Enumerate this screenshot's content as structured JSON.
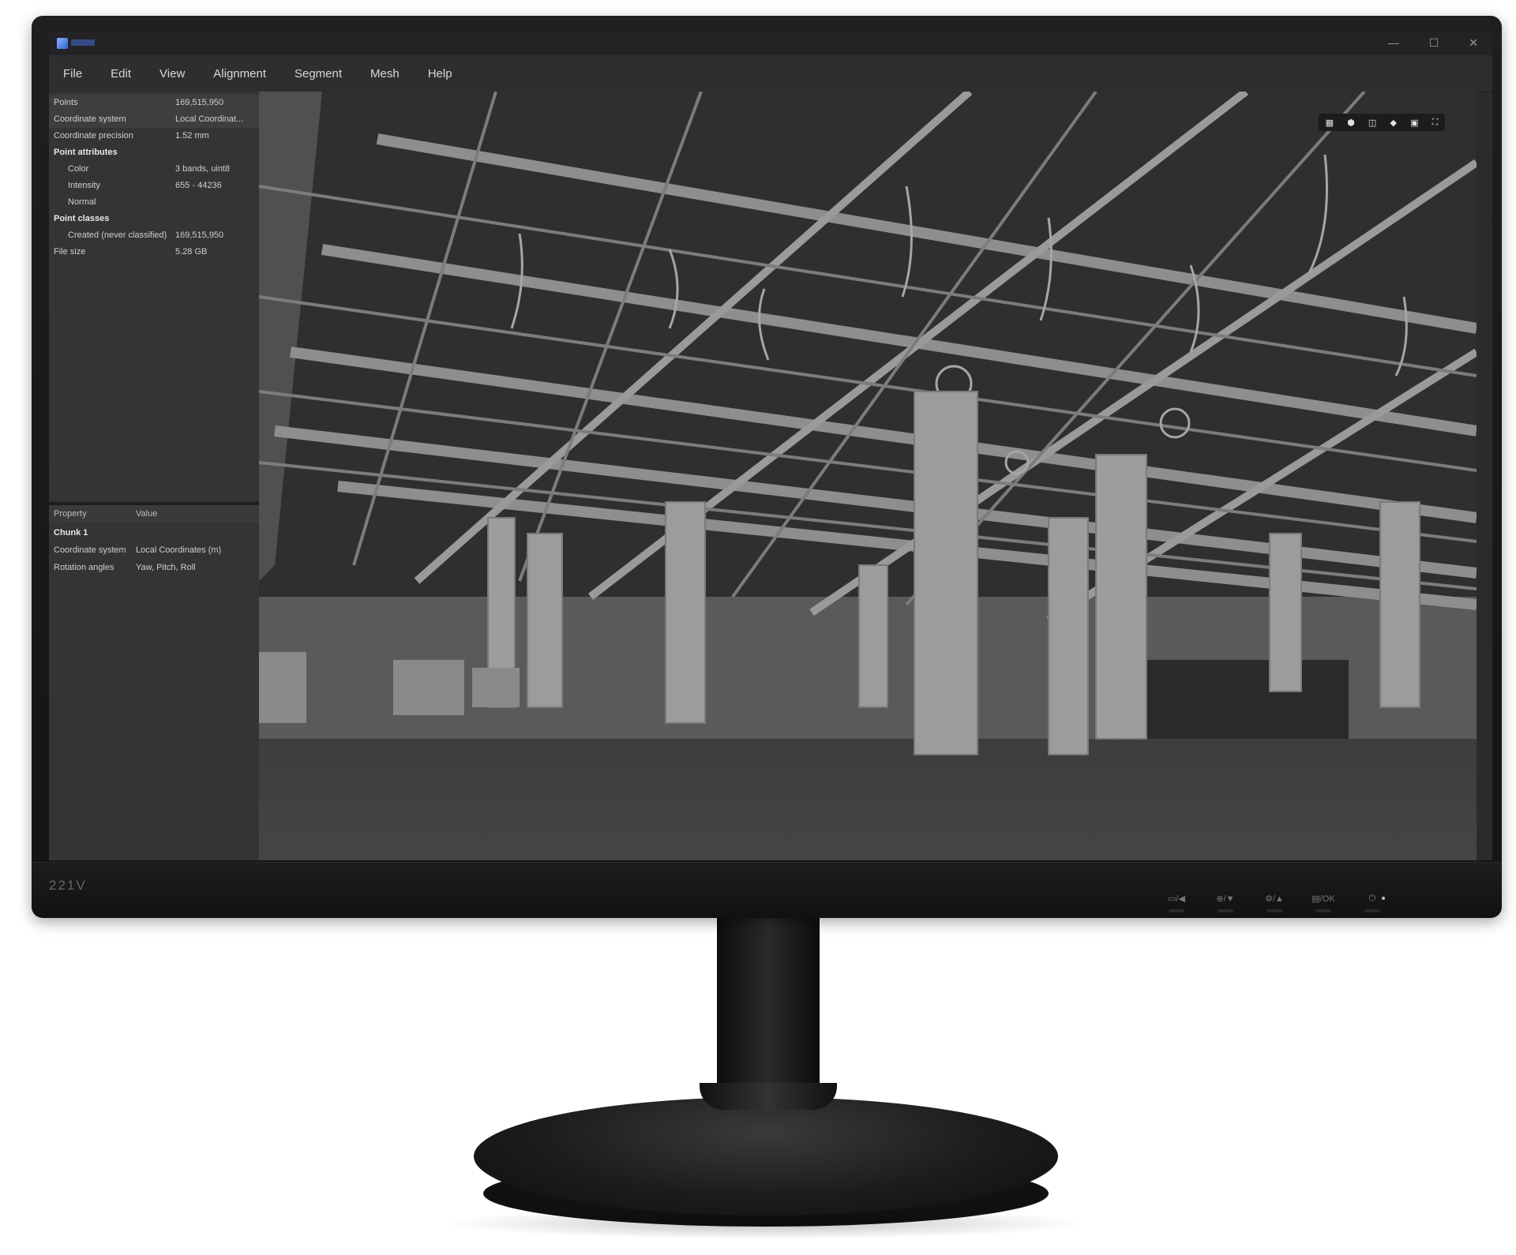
{
  "monitor": {
    "model": "221V",
    "controls": [
      "▭/◀",
      "⊕/▼",
      "⚙/▲",
      "▤/OK",
      "⏻"
    ]
  },
  "window": {
    "controls": {
      "minimize": "—",
      "maximize": "☐",
      "close": "✕"
    }
  },
  "menu": [
    "File",
    "Edit",
    "View",
    "Alignment",
    "Segment",
    "Mesh",
    "Help"
  ],
  "info_panel": {
    "rows": [
      {
        "key": "Points",
        "value": "169,515,950",
        "style": "normal"
      },
      {
        "key": "Coordinate system",
        "value": "Local Coordinat...",
        "style": "normal"
      },
      {
        "key": "Coordinate precision",
        "value": "1.52 mm",
        "style": "normal"
      },
      {
        "key": "Point attributes",
        "value": "",
        "style": "bold"
      },
      {
        "key": "Color",
        "value": "3 bands, uint8",
        "style": "indent"
      },
      {
        "key": "Intensity",
        "value": "655 - 44236",
        "style": "indent"
      },
      {
        "key": "Normal",
        "value": "",
        "style": "indent"
      },
      {
        "key": "Point classes",
        "value": "",
        "style": "bold"
      },
      {
        "key": "Created (never classified)",
        "value": "169,515,950",
        "style": "indent"
      },
      {
        "key": "File size",
        "value": "5.28 GB",
        "style": "normal"
      }
    ]
  },
  "property_panel": {
    "header": {
      "property": "Property",
      "value": "Value"
    },
    "rows": [
      {
        "key": "Chunk 1",
        "value": "",
        "style": "bold"
      },
      {
        "key": "Coordinate system",
        "value": "Local Coordinates (m)",
        "style": "normal"
      },
      {
        "key": "Rotation angles",
        "value": "Yaw, Pitch, Roll",
        "style": "normal"
      }
    ]
  },
  "viewport": {
    "toolbar_icons": [
      "grid-icon",
      "cube-icon",
      "split-view-icon",
      "tag-icon",
      "layers-icon",
      "screenshot-icon"
    ],
    "toolbar_glyphs": [
      "▦",
      "⬢",
      "◫",
      "◆",
      "▣",
      "⛶"
    ]
  }
}
